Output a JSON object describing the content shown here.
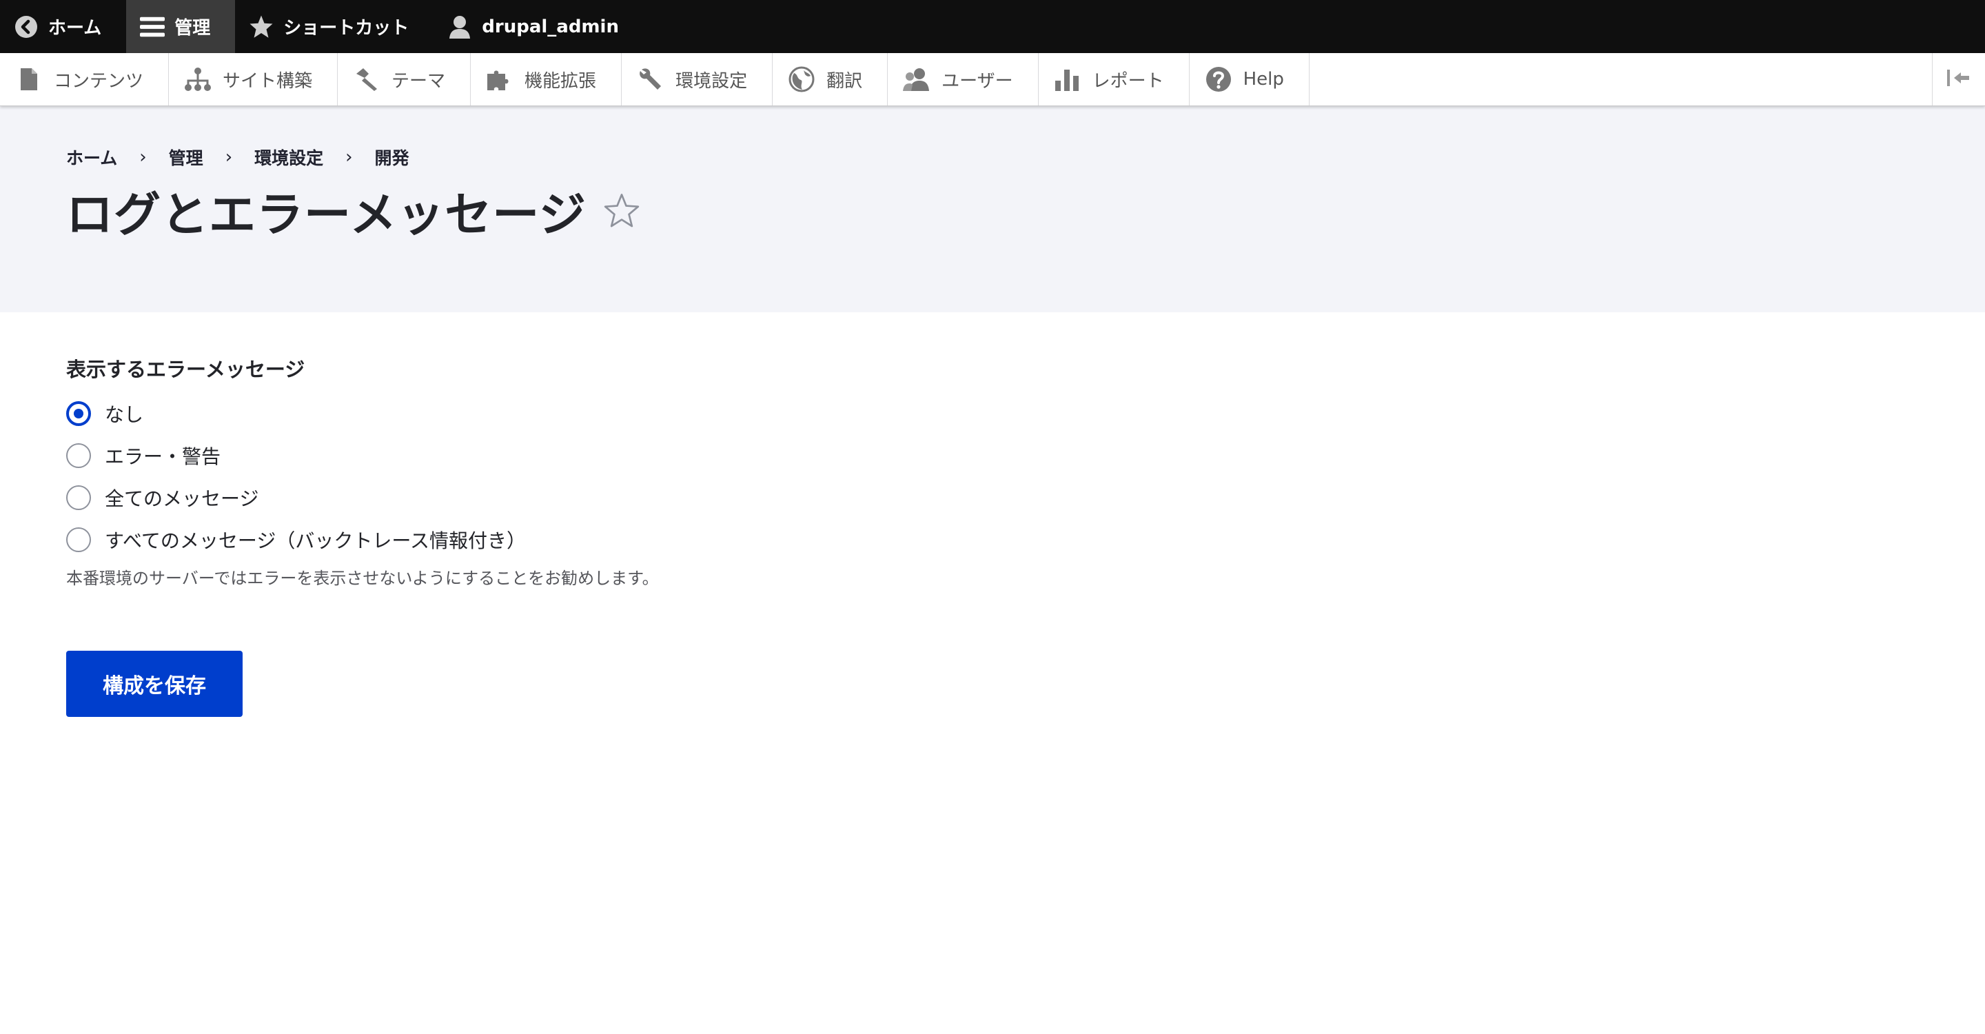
{
  "toolbar": {
    "home_label": "ホーム",
    "manage_label": "管理",
    "shortcuts_label": "ショートカット",
    "user_label": "drupal_admin"
  },
  "tray": {
    "items": [
      {
        "label": "コンテンツ",
        "icon": "document-icon"
      },
      {
        "label": "サイト構築",
        "icon": "sitemap-icon"
      },
      {
        "label": "テーマ",
        "icon": "paint-brush-icon"
      },
      {
        "label": "機能拡張",
        "icon": "puzzle-icon"
      },
      {
        "label": "環境設定",
        "icon": "wrench-icon"
      },
      {
        "label": "翻訳",
        "icon": "globe-icon"
      },
      {
        "label": "ユーザー",
        "icon": "users-icon"
      },
      {
        "label": "レポート",
        "icon": "bar-chart-icon"
      },
      {
        "label": "Help",
        "icon": "help-icon"
      }
    ]
  },
  "breadcrumb": [
    "ホーム",
    "管理",
    "環境設定",
    "開発"
  ],
  "page": {
    "title": "ログとエラーメッセージ"
  },
  "form": {
    "legend": "表示するエラーメッセージ",
    "options": [
      {
        "label": "なし",
        "checked": true
      },
      {
        "label": "エラー・警告",
        "checked": false
      },
      {
        "label": "全てのメッセージ",
        "checked": false
      },
      {
        "label": "すべてのメッセージ（バックトレース情報付き）",
        "checked": false
      }
    ],
    "help": "本番環境のサーバーではエラーを表示させないようにすることをお勧めします。",
    "submit_label": "構成を保存"
  },
  "colors": {
    "accent": "#003ecc",
    "toolbar_bg": "#0f0f0f",
    "header_bg": "#f3f4f9"
  }
}
